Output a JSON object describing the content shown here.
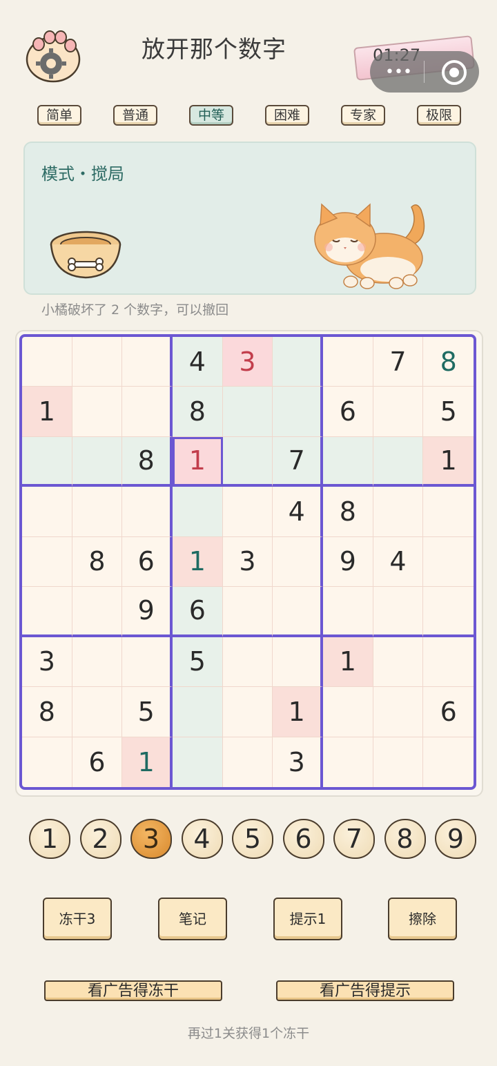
{
  "header": {
    "title": "放开那个数字",
    "timer": "01:27",
    "capsule_dots": "•••"
  },
  "difficulty_tabs": [
    {
      "label": "简单",
      "active": false
    },
    {
      "label": "普通",
      "active": false
    },
    {
      "label": "中等",
      "active": true
    },
    {
      "label": "困难",
      "active": false
    },
    {
      "label": "专家",
      "active": false
    },
    {
      "label": "极限",
      "active": false
    }
  ],
  "mode": {
    "label": "模式・搅局",
    "hint": "小橘破坏了 2 个数字，可以撤回"
  },
  "board": {
    "rows": [
      [
        "",
        "",
        "",
        "4",
        "3",
        "",
        "",
        "7",
        "8"
      ],
      [
        "1",
        "",
        "",
        "8",
        "",
        "",
        "6",
        "",
        "5"
      ],
      [
        "",
        "",
        "8",
        "1",
        "",
        "7",
        "",
        "",
        "1"
      ],
      [
        "",
        "",
        "",
        "",
        "",
        "4",
        "8",
        "",
        ""
      ],
      [
        "",
        "8",
        "6",
        "1",
        "3",
        "",
        "9",
        "4",
        ""
      ],
      [
        "",
        "",
        "9",
        "6",
        "",
        "",
        "",
        "",
        ""
      ],
      [
        "3",
        "",
        "",
        "5",
        "",
        "",
        "1",
        "",
        ""
      ],
      [
        "8",
        "",
        "5",
        "",
        "",
        "1",
        "",
        "",
        "6"
      ],
      [
        "",
        "6",
        "1",
        "",
        "",
        "3",
        "",
        "",
        ""
      ]
    ],
    "selected": {
      "row": 2,
      "col": 3
    },
    "error_cells": [
      [
        0,
        4
      ],
      [
        2,
        3
      ]
    ],
    "user_cells": [
      [
        0,
        8
      ],
      [
        2,
        3
      ],
      [
        4,
        3
      ],
      [
        8,
        2
      ]
    ],
    "same_digit_cells": [
      [
        1,
        0
      ],
      [
        2,
        8
      ],
      [
        4,
        3
      ],
      [
        6,
        6
      ],
      [
        7,
        5
      ],
      [
        8,
        2
      ]
    ]
  },
  "number_pad": {
    "digits": [
      "1",
      "2",
      "3",
      "4",
      "5",
      "6",
      "7",
      "8",
      "9"
    ],
    "selected": "3"
  },
  "actions": [
    {
      "name": "freeze",
      "label": "冻干3"
    },
    {
      "name": "notes",
      "label": "笔记"
    },
    {
      "name": "hint",
      "label": "提示1"
    },
    {
      "name": "erase",
      "label": "擦除"
    }
  ],
  "ads": [
    {
      "name": "freeze",
      "label": "看广告得冻干"
    },
    {
      "name": "hint",
      "label": "看广告得提示"
    }
  ],
  "footer": "再过1关获得1个冻干",
  "colors": {
    "background": "#f5f1e8",
    "board_border": "#6b57d2",
    "highlight": "#e8f1ea",
    "error": "#c23e4c",
    "user_digit": "#1f6b62"
  }
}
